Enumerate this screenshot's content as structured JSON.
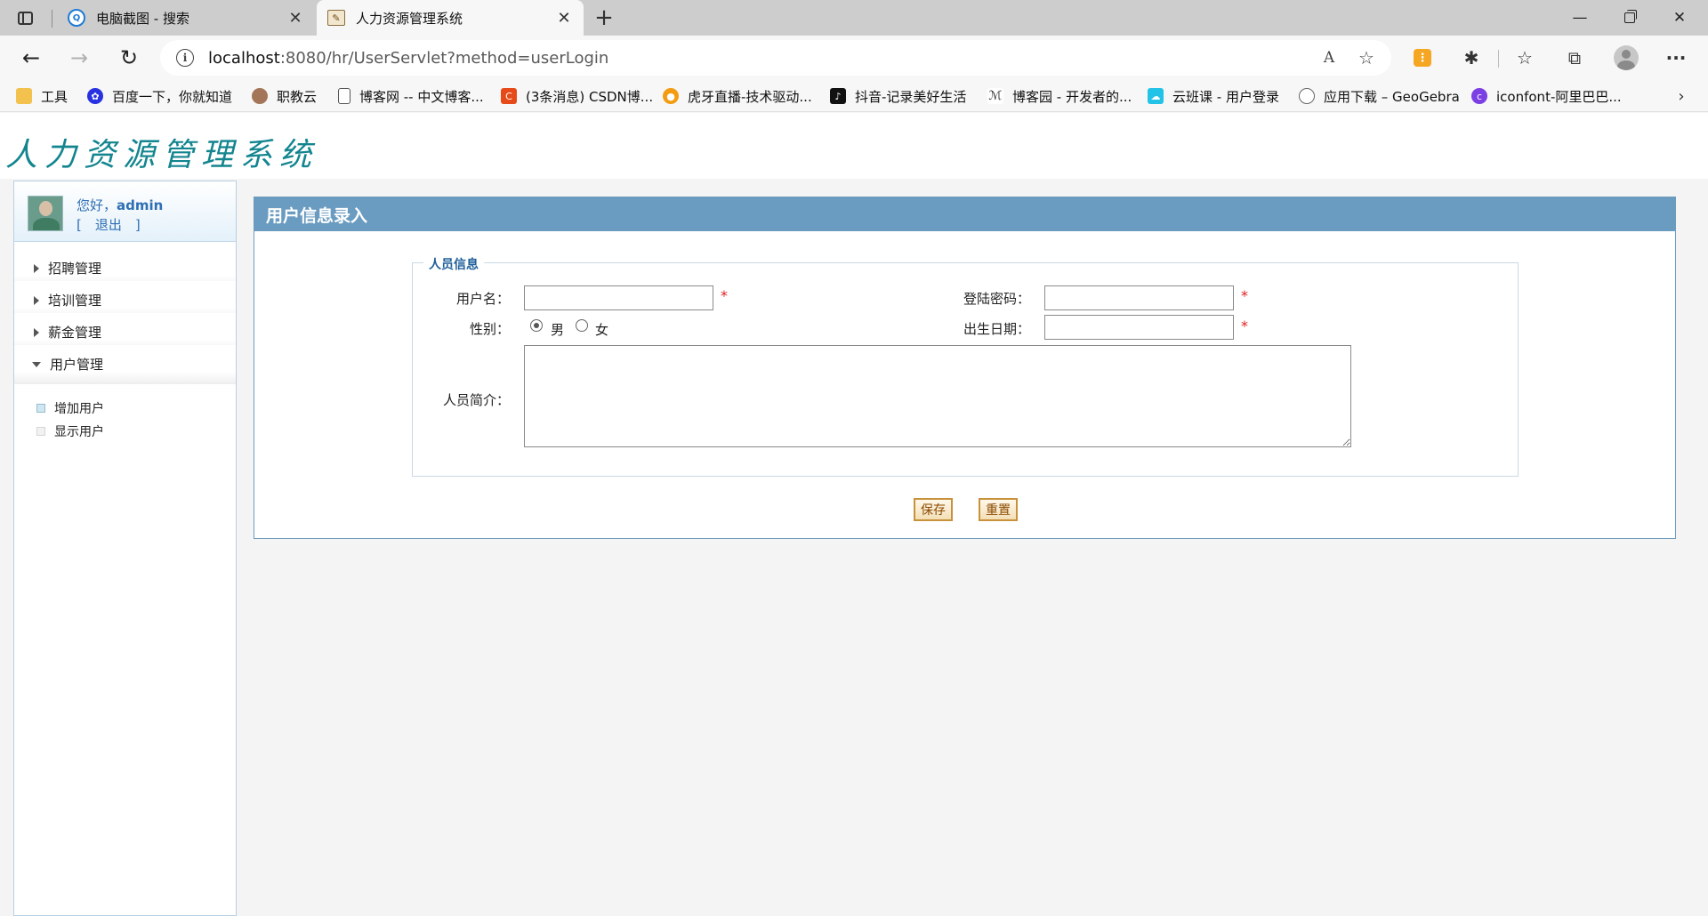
{
  "browser": {
    "tabs": [
      {
        "label": "电脑截图 - 搜索"
      },
      {
        "label": "人力资源管理系统"
      }
    ],
    "url_host": "localhost",
    "url_rest": ":8080/hr/UserServlet?method=userLogin",
    "bookmarks": [
      {
        "label": "工具",
        "icon": "folder-icon",
        "color": "#f2c14e"
      },
      {
        "label": "百度一下，你就知道",
        "icon": "baidu-paw-icon",
        "color": "#2932e1"
      },
      {
        "label": "职教云",
        "icon": "zhijiaoyun-icon",
        "color": "#a37659"
      },
      {
        "label": "博客网 -- 中文博客...",
        "icon": "page-icon",
        "color": "#555555"
      },
      {
        "label": "(3条消息) CSDN博...",
        "icon": "csdn-icon",
        "color": "#e64a19"
      },
      {
        "label": "虎牙直播-技术驱动...",
        "icon": "huya-icon",
        "color": "#f39c12"
      },
      {
        "label": "抖音-记录美好生活",
        "icon": "douyin-icon",
        "color": "#111111"
      },
      {
        "label": "博客园 - 开发者的...",
        "icon": "cnblogs-icon",
        "color": "#333333"
      },
      {
        "label": "云班课 - 用户登录",
        "icon": "yunbanke-icon",
        "color": "#22c3e6"
      },
      {
        "label": "应用下载 – GeoGebra",
        "icon": "geogebra-icon",
        "color": "#666666"
      },
      {
        "label": "iconfont-阿里巴巴...",
        "icon": "iconfont-icon",
        "color": "#7b3fe4"
      }
    ]
  },
  "app": {
    "logo_text": "人力资源管理系统",
    "user": {
      "greeting": "您好，",
      "name": "admin",
      "logout": "[　退出　]"
    },
    "menu": [
      {
        "label": "招聘管理",
        "expanded": false
      },
      {
        "label": "培训管理",
        "expanded": false
      },
      {
        "label": "薪金管理",
        "expanded": false
      },
      {
        "label": "用户管理",
        "expanded": true
      }
    ],
    "submenu": [
      {
        "label": "增加用户",
        "active": true
      },
      {
        "label": "显示用户",
        "active": false
      }
    ],
    "form": {
      "title": "用户信息录入",
      "legend": "人员信息",
      "username_label": "用户名：",
      "password_label": "登陆密码：",
      "gender_label": "性别：",
      "gender_options": [
        {
          "label": "男",
          "selected": true
        },
        {
          "label": "女",
          "selected": false
        }
      ],
      "birthday_label": "出生日期：",
      "intro_label": "人员简介：",
      "required_mark": "*",
      "username_value": "",
      "password_value": "",
      "birthday_value": "",
      "intro_value": "",
      "save_label": "保存",
      "reset_label": "重置"
    }
  },
  "colors": {
    "panel_header": "#6a9bc0",
    "logo": "#13858f",
    "link": "#2f6fb4",
    "required": "#e02020"
  }
}
